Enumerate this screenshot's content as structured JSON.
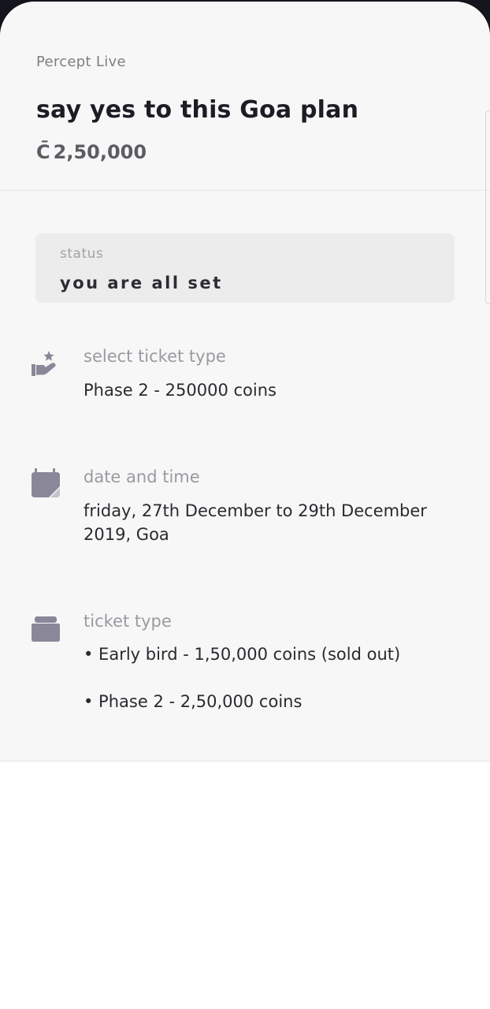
{
  "event": {
    "provider": "Percept Live",
    "title": "say yes to this Goa plan",
    "coin_symbol": "C̄",
    "price": "2,50,000"
  },
  "status": {
    "label": "status",
    "value": "you are all set"
  },
  "ticket_select": {
    "label": "select ticket type",
    "value": "Phase 2 - 250000 coins",
    "icon": "hand-star-icon"
  },
  "date_time": {
    "label": "date and time",
    "value": "friday, 27th December to 29th December 2019, Goa",
    "icon": "calendar-icon"
  },
  "ticket_types": {
    "label": "ticket type",
    "icon": "ticket-icon",
    "items": [
      "• Early bird - 1,50,000 coins (sold out)",
      "• Phase 2 - 2,50,000 coins"
    ]
  },
  "colors": {
    "icon": "#8a8798",
    "background": "#f7f7f7",
    "status_box": "#ececec"
  }
}
